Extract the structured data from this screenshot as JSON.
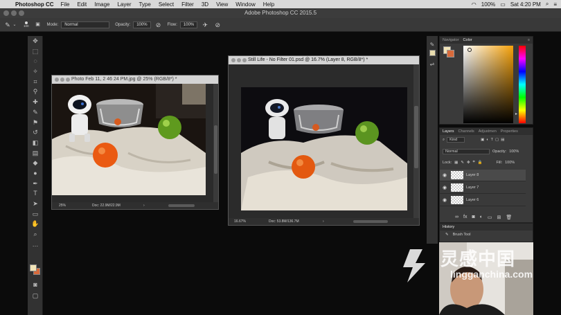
{
  "menubar": {
    "app": "Photoshop CC",
    "items": [
      "File",
      "Edit",
      "Image",
      "Layer",
      "Type",
      "Select",
      "Filter",
      "3D",
      "View",
      "Window",
      "Help"
    ],
    "battery": "100%",
    "clock": "Sat 4:20 PM"
  },
  "window": {
    "title": "Adobe Photoshop CC 2015.5"
  },
  "options": {
    "brush_size": "100",
    "mode_label": "Mode:",
    "mode_value": "Normal",
    "opacity_label": "Opacity:",
    "opacity_value": "100%",
    "flow_label": "Flow:",
    "flow_value": "100%"
  },
  "doc1": {
    "title": "Photo Feb 11, 2 46 24 PM.jpg @ 25% (RGB/8*) *",
    "zoom": "25%",
    "doc_size": "Doc: 22.9M/22.9M"
  },
  "doc2": {
    "title": "Still Life - No Filter 01.psd @ 16.7% (Layer 8, RGB/8*) *",
    "zoom": "16.67%",
    "doc_size": "Doc: 53.8M/136.7M"
  },
  "color_panel": {
    "tabs": [
      "Navigator",
      "Color"
    ],
    "active": "Color",
    "fg": "#f2e4b8",
    "bg": "#d86a3b"
  },
  "layers_panel": {
    "tabs": [
      "Layers",
      "Channels",
      "Adjustmen",
      "Properties"
    ],
    "kind": "Kind",
    "blend": "Normal",
    "opacity_label": "Opacity:",
    "opacity": "100%",
    "lock_label": "Lock:",
    "fill_label": "Fill:",
    "fill": "100%",
    "layers": [
      {
        "name": "Layer 8"
      },
      {
        "name": "Layer 7"
      },
      {
        "name": "Layer 6"
      }
    ]
  },
  "history_panel": {
    "title": "History",
    "items": [
      "Brush Tool"
    ]
  },
  "watermark": {
    "cn": "灵感中国",
    "url": "lingganchina.com"
  }
}
